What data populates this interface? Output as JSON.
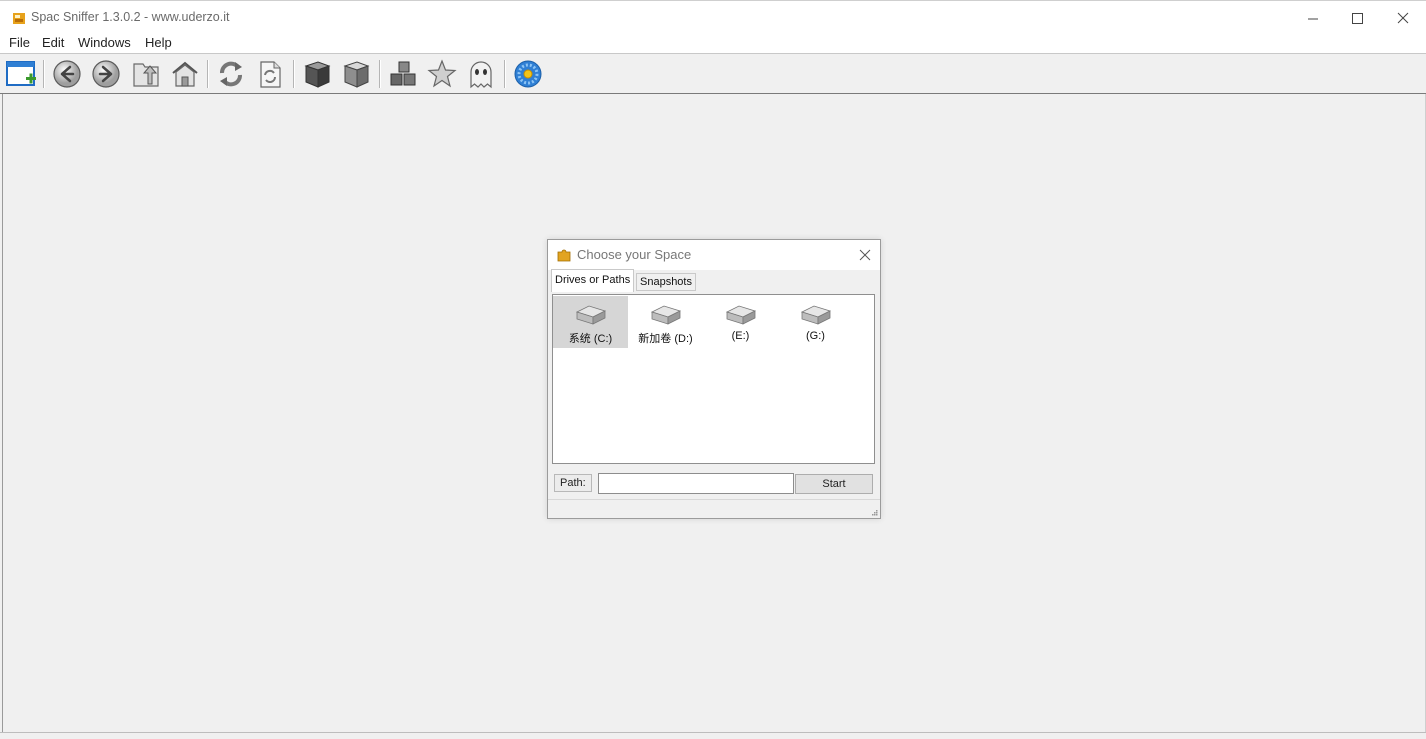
{
  "window": {
    "title": "Spac Sniffer 1.3.0.2 - www.uderzo.it",
    "controls": {
      "minimize": "minimize",
      "maximize": "maximize",
      "close": "close"
    }
  },
  "menu": [
    {
      "label": "File"
    },
    {
      "label": "Edit"
    },
    {
      "label": "Windows"
    },
    {
      "label": "Help"
    }
  ],
  "toolbar": {
    "buttons": [
      {
        "icon": "new-window-icon"
      },
      {
        "icon": "back-arrow-icon"
      },
      {
        "icon": "forward-arrow-icon"
      },
      {
        "icon": "up-folder-icon"
      },
      {
        "icon": "home-icon"
      },
      {
        "icon": "refresh-icon"
      },
      {
        "icon": "refresh-document-icon"
      },
      {
        "icon": "cube-dark-icon"
      },
      {
        "icon": "cube-light-icon"
      },
      {
        "icon": "cubes-icon"
      },
      {
        "icon": "star-icon"
      },
      {
        "icon": "ghost-icon"
      },
      {
        "icon": "gear-flower-icon"
      }
    ]
  },
  "dialog": {
    "title": "Choose your Space",
    "tabs": [
      {
        "label": "Drives or Paths",
        "active": true
      },
      {
        "label": "Snapshots",
        "active": false
      }
    ],
    "drives": [
      {
        "label": "系统 (C:)",
        "selected": true
      },
      {
        "label": "新加卷 (D:)",
        "selected": false
      },
      {
        "label": "(E:)",
        "selected": false
      },
      {
        "label": "(G:)",
        "selected": false
      }
    ],
    "path_label": "Path:",
    "path_value": "",
    "start_label": "Start"
  },
  "colors": {
    "accent_blue": "#2f7fd4",
    "window_bg": "#f0f0f0",
    "selected_drive_bg": "#d6d6d6"
  }
}
